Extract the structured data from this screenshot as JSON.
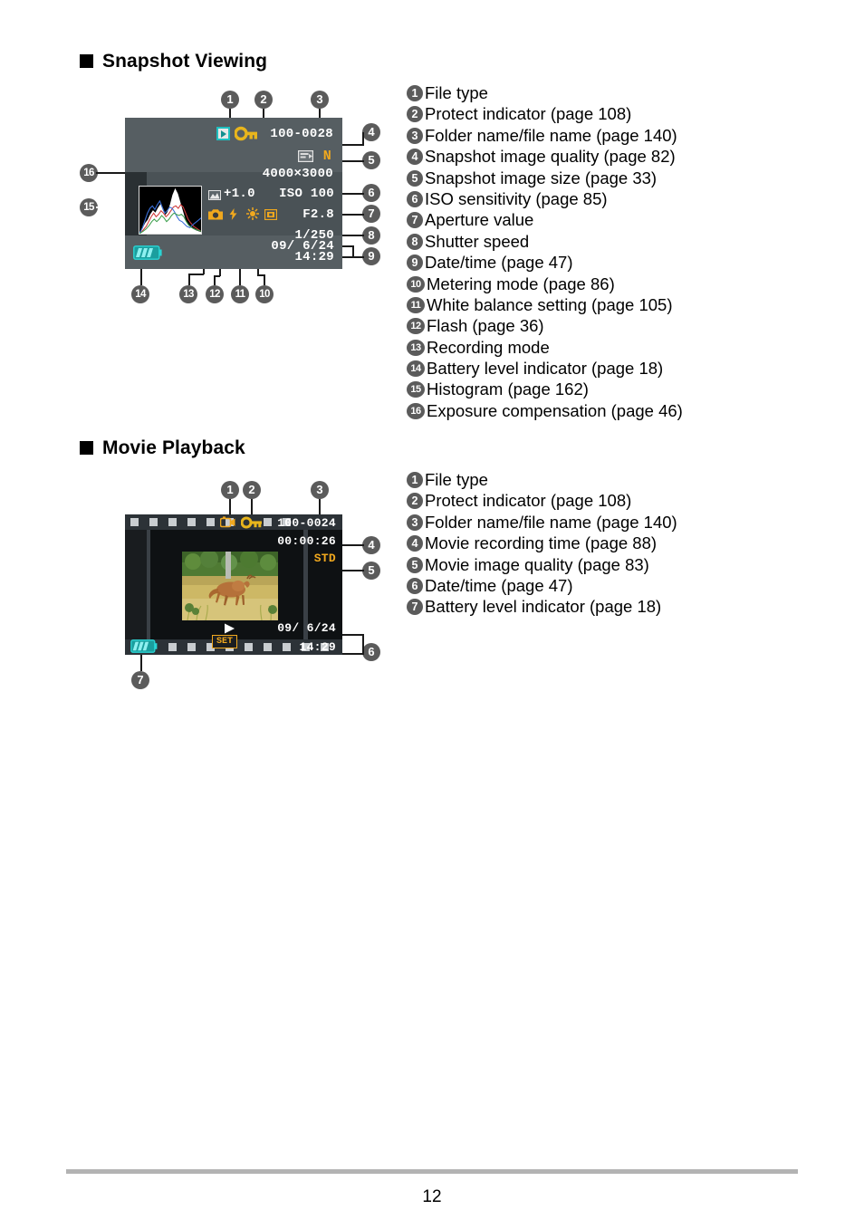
{
  "page": {
    "number": "12"
  },
  "sections": [
    {
      "id": "snapshot",
      "heading": "Snapshot Viewing",
      "legend": [
        {
          "n": "1",
          "label": "File type"
        },
        {
          "n": "2",
          "label": "Protect indicator (page 108)"
        },
        {
          "n": "3",
          "label": "Folder name/file name (page 140)"
        },
        {
          "n": "4",
          "label": "Snapshot image quality (page 82)"
        },
        {
          "n": "5",
          "label": "Snapshot image size (page 33)"
        },
        {
          "n": "6",
          "label": "ISO sensitivity (page 85)"
        },
        {
          "n": "7",
          "label": "Aperture value"
        },
        {
          "n": "8",
          "label": "Shutter speed"
        },
        {
          "n": "9",
          "label": "Date/time (page 47)"
        },
        {
          "n": "10",
          "label": "Metering mode (page 86)"
        },
        {
          "n": "11",
          "label": "White balance setting (page 105)"
        },
        {
          "n": "12",
          "label": "Flash (page 36)"
        },
        {
          "n": "13",
          "label": "Recording mode"
        },
        {
          "n": "14",
          "label": "Battery level indicator (page 18)"
        },
        {
          "n": "15",
          "label": "Histogram (page 162)"
        },
        {
          "n": "16",
          "label": "Exposure compensation (page 46)"
        }
      ],
      "lcd": {
        "file_number": "100-0028",
        "image_quality": "N",
        "image_size": "4000×3000",
        "exposure_compensation": "+1.0",
        "iso": "ISO 100",
        "aperture": "F2.8",
        "shutter_speed": "1/250",
        "date": "09/  6/24",
        "time": "14:29",
        "icons": [
          "file-type-play-icon",
          "protect-key-icon",
          "image-quality-icon",
          "exposure-compensation-icon",
          "recording-mode-icon",
          "flash-icon",
          "white-balance-sun-icon",
          "metering-mode-icon",
          "battery-level-icon",
          "histogram"
        ]
      },
      "callouts": [
        "1",
        "2",
        "3",
        "4",
        "5",
        "6",
        "7",
        "8",
        "9",
        "10",
        "11",
        "12",
        "13",
        "14",
        "15",
        "16"
      ]
    },
    {
      "id": "movie",
      "heading": "Movie Playback",
      "legend": [
        {
          "n": "1",
          "label": "File type"
        },
        {
          "n": "2",
          "label": "Protect indicator (page 108)"
        },
        {
          "n": "3",
          "label": "Folder name/file name (page 140)"
        },
        {
          "n": "4",
          "label": "Movie recording time (page 88)"
        },
        {
          "n": "5",
          "label": "Movie image quality (page 83)"
        },
        {
          "n": "6",
          "label": "Date/time (page 47)"
        },
        {
          "n": "7",
          "label": "Battery level indicator (page 18)"
        }
      ],
      "lcd": {
        "file_number": "100-0024",
        "recording_time": "00:00:26",
        "image_quality": "STD",
        "date": "09/  6/24",
        "time": "14:29",
        "set_label": "SET",
        "icons": [
          "movie-file-type-icon",
          "protect-key-icon",
          "play-triangle-icon",
          "battery-level-icon"
        ]
      },
      "callouts": [
        "1",
        "2",
        "3",
        "4",
        "5",
        "6",
        "7"
      ]
    }
  ],
  "colors": {
    "lcd_background": "#565e62",
    "lcd_band": "#4a5256",
    "amber": "#f0a81e",
    "teal": "#1fbfbf",
    "badge_gray": "#5b5b5b",
    "film_black": "#191c1f",
    "footer_rule": "#b3b3b3"
  }
}
